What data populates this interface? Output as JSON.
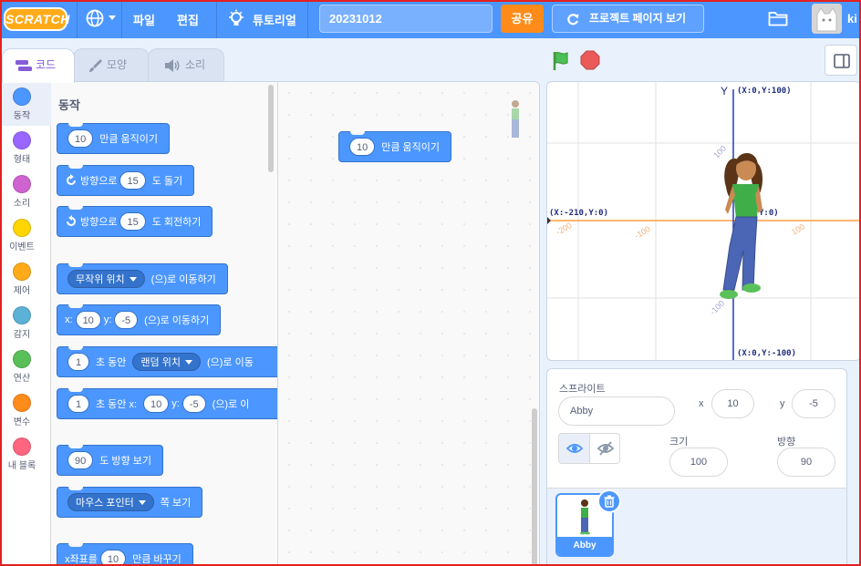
{
  "app": {
    "logo_text": "SCRATCH",
    "menu": {
      "file": "파일",
      "edit": "편집",
      "tutorials": "튜토리얼"
    },
    "project_title": "20231012",
    "share_label": "공유",
    "project_page_label": "프로젝트 페이지 보기",
    "username": "ki"
  },
  "tabs": {
    "code": "코드",
    "costumes": "모양",
    "sounds": "소리"
  },
  "categories": [
    {
      "label": "동작",
      "color": "#4c97ff"
    },
    {
      "label": "형태",
      "color": "#9966ff"
    },
    {
      "label": "소리",
      "color": "#cf63cf"
    },
    {
      "label": "이벤트",
      "color": "#ffd500"
    },
    {
      "label": "제어",
      "color": "#ffab19"
    },
    {
      "label": "감지",
      "color": "#5cb1d6"
    },
    {
      "label": "연산",
      "color": "#59c059"
    },
    {
      "label": "변수",
      "color": "#ff8c1a"
    },
    {
      "label": "내 블록",
      "color": "#ff6680"
    }
  ],
  "palette": {
    "title": "동작",
    "move": {
      "value": "10",
      "text": "만큼 움직이기"
    },
    "turn_right": {
      "prefix": "방향으로",
      "value": "15",
      "suffix": "도 돌기"
    },
    "turn_left": {
      "prefix": "방향으로",
      "value": "15",
      "suffix": "도 회전하기"
    },
    "goto": {
      "option": "무작위 위치",
      "suffix": "(으)로 이동하기"
    },
    "goto_xy": {
      "x_label": "x:",
      "x": "10",
      "y_label": "y:",
      "y": "-5",
      "suffix": "(으)로 이동하기"
    },
    "glide": {
      "secs": "1",
      "mid": "초 동안",
      "option": "랜덤 위치",
      "suffix": "(으)로 이동"
    },
    "glide_xy": {
      "secs": "1",
      "mid": "초 동안 x:",
      "x": "10",
      "y_label": "y:",
      "y": "-5",
      "suffix": "(으)로 이"
    },
    "point_dir": {
      "value": "90",
      "suffix": "도 방향 보기"
    },
    "point_towards": {
      "option": "마우스 포인터",
      "suffix": "쪽 보기"
    },
    "change_x": {
      "prefix": "x좌표를",
      "value": "10",
      "suffix": "만큼 바꾸기"
    }
  },
  "workspace": {
    "block": {
      "value": "10",
      "text": "만큼 움직이기"
    }
  },
  "stage": {
    "axis_y_label": "Y",
    "top_label": "(X:0,Y:100)",
    "left_label": "(X:-210,Y:0)",
    "center_label": "Y:0)",
    "bottom_label": "(X:0,Y:-100)",
    "tick_minus100": "-100",
    "tick_minus200": "-200",
    "tick_100": "100",
    "tick_100_y": "100",
    "tick_minus100_y": "-100"
  },
  "sprite_info": {
    "sprite_label": "스프라이트",
    "sprite_name": "Abby",
    "x_label": "x",
    "x_value": "10",
    "y_label": "y",
    "y_value": "-5",
    "size_label": "크기",
    "size_value": "100",
    "direction_label": "방향",
    "direction_value": "90",
    "tile_name": "Abby"
  }
}
